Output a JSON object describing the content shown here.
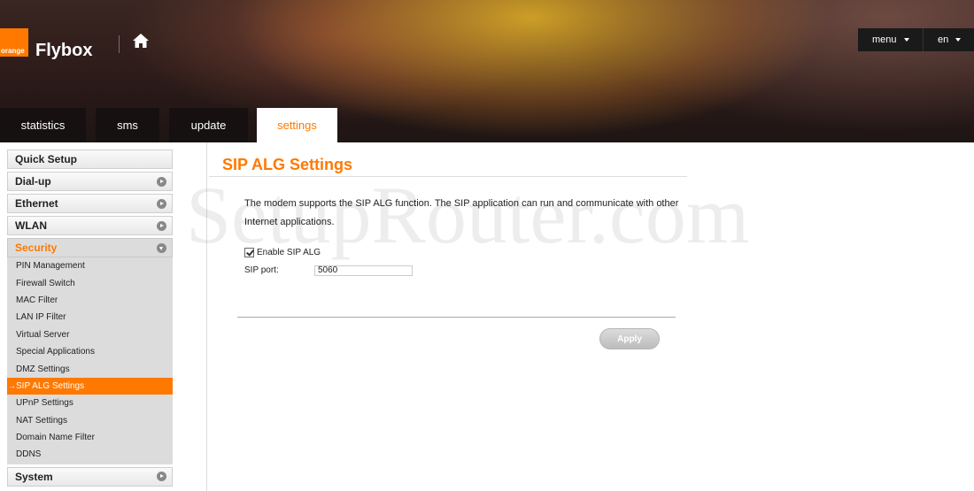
{
  "header": {
    "logo_text": "orange",
    "brand": "Flybox",
    "menu_label": "menu",
    "lang_label": "en"
  },
  "tabs": [
    {
      "label": "statistics",
      "active": false
    },
    {
      "label": "sms",
      "active": false
    },
    {
      "label": "update",
      "active": false
    },
    {
      "label": "settings",
      "active": true
    }
  ],
  "sidebar": {
    "sections": [
      {
        "label": "Quick Setup",
        "arrow": false
      },
      {
        "label": "Dial-up",
        "arrow": true
      },
      {
        "label": "Ethernet",
        "arrow": true
      },
      {
        "label": "WLAN",
        "arrow": true
      },
      {
        "label": "Security",
        "arrow": true,
        "open": true
      },
      {
        "label": "System",
        "arrow": true
      }
    ],
    "security_items": [
      "PIN Management",
      "Firewall Switch",
      "MAC Filter",
      "LAN IP Filter",
      "Virtual Server",
      "Special Applications",
      "DMZ Settings",
      "SIP ALG Settings",
      "UPnP Settings",
      "NAT Settings",
      "Domain Name Filter",
      "DDNS"
    ],
    "active_item": "SIP ALG Settings"
  },
  "content": {
    "title": "SIP ALG Settings",
    "description": "The modem supports the SIP ALG function. The SIP application can run and communicate with other Internet applications.",
    "enable_label": "Enable SIP ALG",
    "enable_checked": true,
    "port_label": "SIP port:",
    "port_value": "5060",
    "apply_label": "Apply"
  },
  "watermark": "SetupRouter.com",
  "colors": {
    "accent": "#ff7900"
  }
}
